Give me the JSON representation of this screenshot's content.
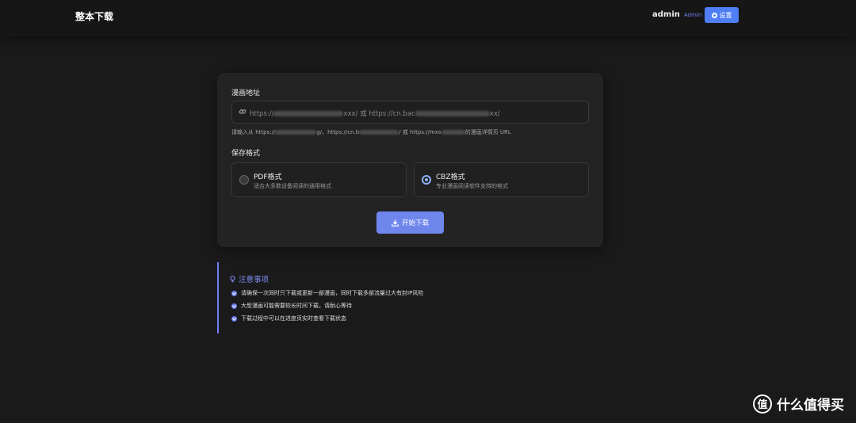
{
  "header": {
    "brand": "整本下载",
    "user_name": "admin",
    "user_role": "Admin",
    "settings_label": "设置"
  },
  "form": {
    "url_label": "漫画地址",
    "url_placeholder_start": "https://",
    "url_placeholder_mid": "xxx/ 或 https://cn.bac",
    "url_placeholder_end": "xx/",
    "help_a": "请输入从 https://",
    "help_b": "g/、https://cn.b",
    "help_c": "/ 或 https://mxs",
    "help_d": "的漫画详情页 URL",
    "format_label": "保存格式",
    "formats": [
      {
        "title": "PDF格式",
        "desc": "适合大多数设备阅读的通用格式",
        "checked": false
      },
      {
        "title": "CBZ格式",
        "desc": "专业漫画阅读软件支持的格式",
        "checked": true
      }
    ],
    "start_label": "开始下载"
  },
  "notes": {
    "title": "注意事项",
    "items": [
      "请确保一次同时只下载或更新一部漫画，同时下载多部流量过大有封IP风险",
      "大型漫画可能需要较长时间下载，请耐心等待",
      "下载过程中可以在进度页实时查看下载状态"
    ]
  },
  "watermark": {
    "logo": "值",
    "text": "什么值得买"
  },
  "colors": {
    "accent": "#6d7ff0",
    "settings_button": "#4f7ef5",
    "start_button": "#6f86ec",
    "background": "#1a1a1b"
  }
}
